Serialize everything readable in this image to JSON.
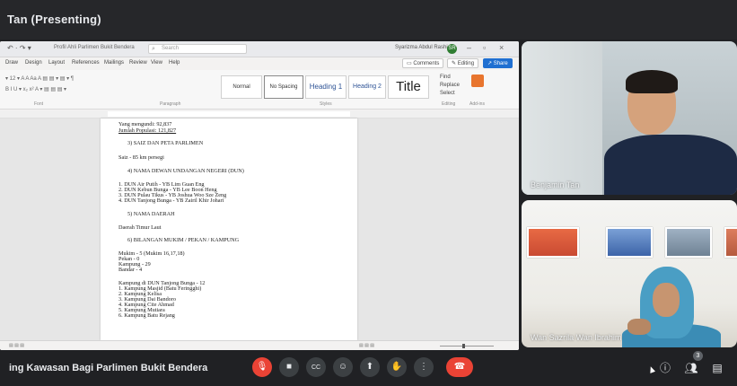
{
  "header": {
    "presenting_title": "Tan (Presenting)"
  },
  "word": {
    "titlebar": {
      "quick_access": "↶ · ↷ ▾",
      "file_name": "Profil Ahli Parlimen Bukit Bendera",
      "search_placeholder": "Search",
      "user_name": "Syarizma Abdul Rashid",
      "user_initials": "SR"
    },
    "tabs": [
      "Draw",
      "Design",
      "Layout",
      "References",
      "Mailings",
      "Review",
      "View",
      "Help"
    ],
    "ribbon_buttons": {
      "comments": "Comments",
      "editing": "Editing",
      "share": "Share"
    },
    "styles": [
      "Normal",
      "No Spacing",
      "Heading 1",
      "Heading 2",
      "Title"
    ],
    "editing_group": [
      "Find",
      "Replace",
      "Select"
    ],
    "addins_label": "Add-ins",
    "group_labels": {
      "font": "Font",
      "paragraph": "Paragraph",
      "styles": "Styles",
      "editing": "Editing"
    },
    "document_lines": [
      "Yang mengundi: 92,837",
      "Jumlah Populasi: 121,827",
      "3)  SAIZ DAN PETA PARLIMEN",
      "Saiz - 85 km persegi",
      "4)  NAMA DEWAN UNDANGAN NEGERI (DUN)",
      "1. DUN Air Putih - YB Lim Guan Eng",
      "2. DUN Kebun Bunga - YB Lee Boon Heng",
      "3. DUN Pulau Tikus - YB Joshua Woo Sze Zeng",
      "4. DUN Tanjong Bunga - YB Zairil Khir Johari",
      "5)  NAMA DAERAH",
      "Daerah Timur Laut",
      "6)  BILANGAN MUKIM / PEKAN / KAMPUNG",
      "Mukim        -  5 (Mukim 16,17,18)",
      "Pekan         -  0",
      "Kampung    -  29",
      "Bandar        -  4",
      "Kampung di DUN Tanjong Bunga - 12",
      "1. Kampung Masjid (Batu Feringghi)",
      "2. Kampung Kelisa",
      "3. Kampung Dai Bandoro",
      "4. Kampung Cite Ahmad",
      "5. Kampung Mutiara",
      "6. Kampung Batu Rejang"
    ]
  },
  "participants": [
    {
      "name": "Benjamin Tan"
    },
    {
      "name": "Wan Sazrila Wan Ibrahim"
    }
  ],
  "bottom_bar": {
    "meeting_name": "ing Kawasan Bagi Parlimen Bukit Bendera",
    "people_count": "3"
  },
  "colors": {
    "hangup": "#ea4335",
    "mic_off": "#ea4335",
    "bar_bg": "#202124",
    "word_share": "#1f6fd1"
  },
  "icons": {
    "mic": "mic-off-icon",
    "camera": "videocam-icon",
    "captions": "captions-icon",
    "emoji": "emoji-icon",
    "present": "present-icon",
    "hand": "raise-hand-icon",
    "more": "more-vert-icon",
    "hangup": "call-end-icon",
    "info": "info-icon",
    "people": "people-icon",
    "chat": "chat-icon"
  }
}
